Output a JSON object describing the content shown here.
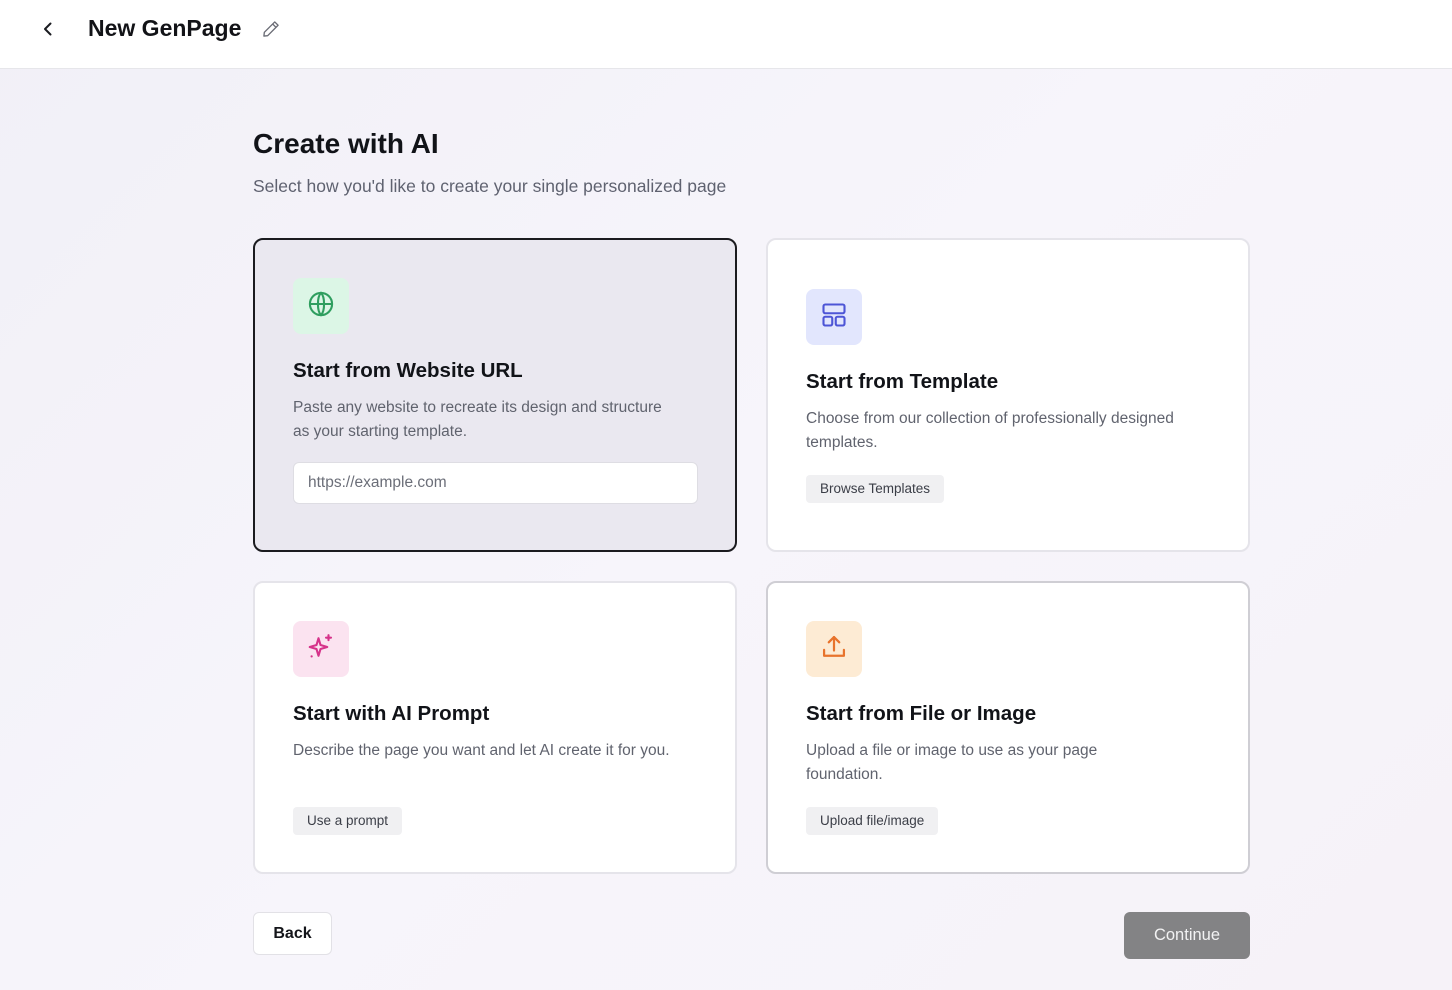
{
  "header": {
    "title": "New GenPage",
    "back_icon": "chevron-left-icon",
    "edit_icon": "pencil-icon"
  },
  "main": {
    "heading": "Create with AI",
    "subheading": "Select how you'd like to create your single personalized page"
  },
  "cards": [
    {
      "id": "website-url",
      "icon": "globe-icon",
      "icon_bg": "#dcf6e6",
      "icon_color": "#2f9e5f",
      "title": "Start from Website URL",
      "description": "Paste any website to recreate its design and structure as your starting template.",
      "input_placeholder": "https://example.com",
      "selected": true
    },
    {
      "id": "template",
      "icon": "layout-template-icon",
      "icon_bg": "#e2e6fd",
      "icon_color": "#4d55d6",
      "title": "Start from Template",
      "description": "Choose from our collection of professionally designed templates.",
      "action_label": "Browse Templates"
    },
    {
      "id": "ai-prompt",
      "icon": "sparkles-icon",
      "icon_bg": "#fbe3f0",
      "icon_color": "#d6338a",
      "title": "Start with AI Prompt",
      "description": "Describe the page you want and let AI create it for you.",
      "action_label": "Use a prompt"
    },
    {
      "id": "file-image",
      "icon": "upload-icon",
      "icon_bg": "#fdebd4",
      "icon_color": "#e8732c",
      "title": "Start from File or Image",
      "description": "Upload a file or image to use as your page foundation.",
      "action_label": "Upload file/image"
    }
  ],
  "footer": {
    "back_label": "Back",
    "continue_label": "Continue"
  }
}
